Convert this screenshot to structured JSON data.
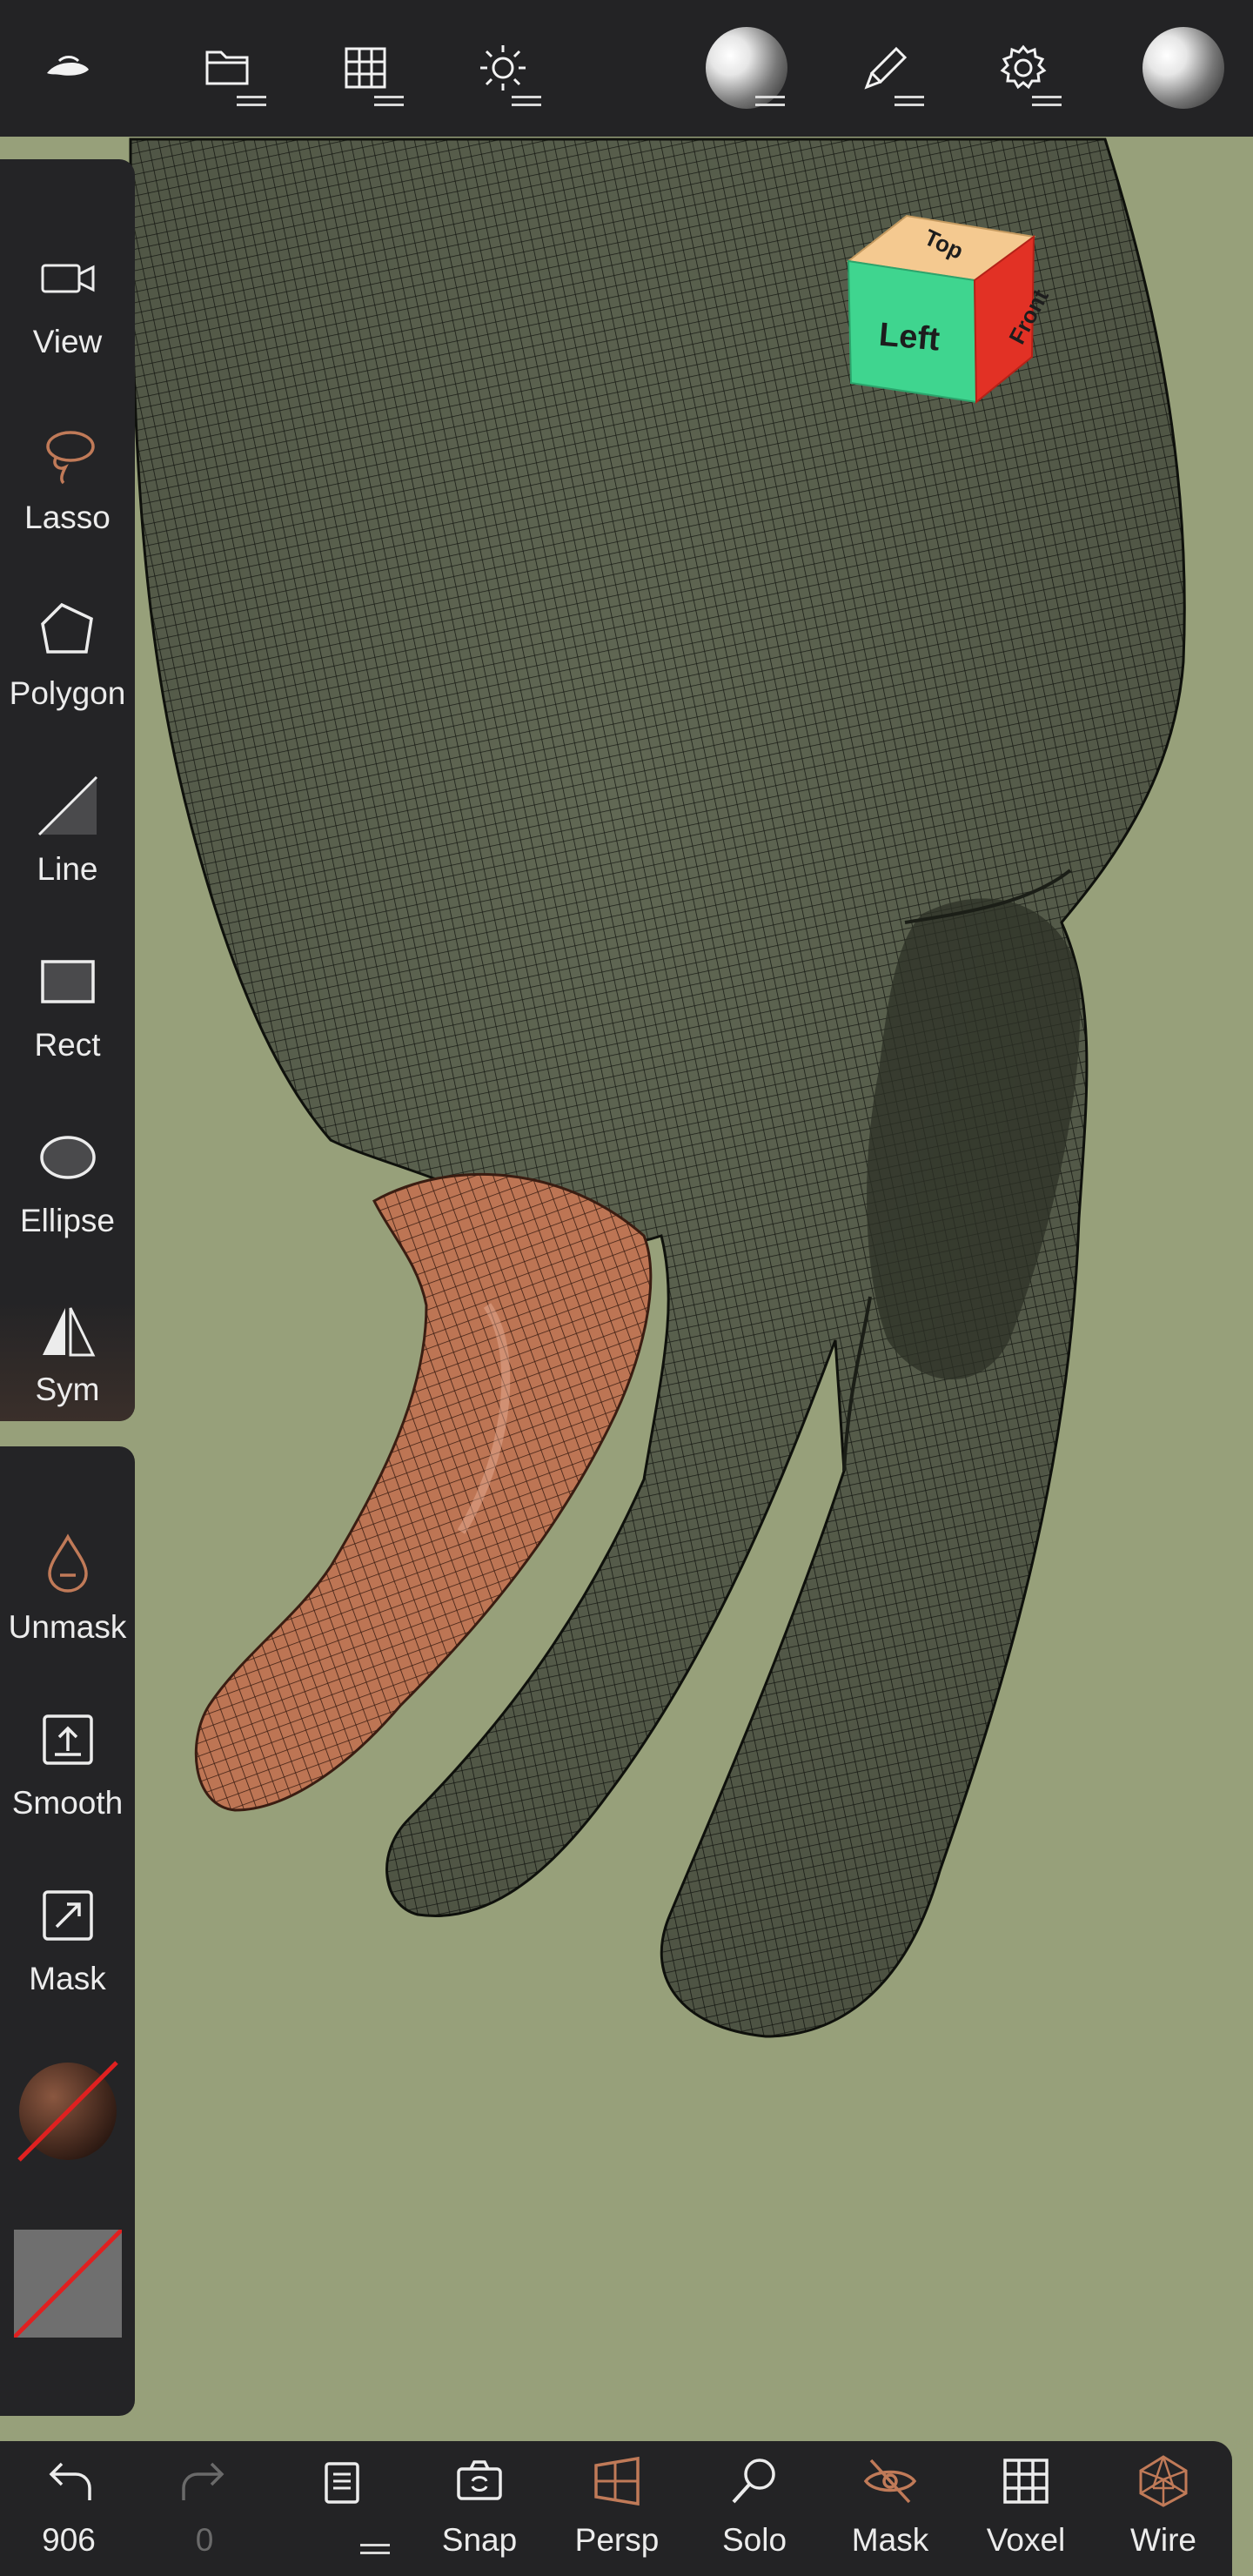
{
  "topbar": {
    "items": [
      {
        "icon": "app-logo-icon"
      },
      {
        "icon": "folder-icon"
      },
      {
        "icon": "grid-icon"
      },
      {
        "icon": "sun-icon"
      },
      {
        "icon": "matcap-sphere-icon"
      },
      {
        "icon": "brush-icon"
      },
      {
        "icon": "gear-icon"
      },
      {
        "icon": "matcap-sphere-icon"
      }
    ]
  },
  "view_cube": {
    "face_left": "Left",
    "face_top": "Top",
    "face_front": "Front"
  },
  "tools_panel": {
    "items": [
      {
        "label": "View",
        "icon": "camera-icon"
      },
      {
        "label": "Lasso",
        "icon": "lasso-icon"
      },
      {
        "label": "Polygon",
        "icon": "polygon-icon"
      },
      {
        "label": "Line",
        "icon": "line-icon"
      },
      {
        "label": "Rect",
        "icon": "rect-icon"
      },
      {
        "label": "Ellipse",
        "icon": "ellipse-icon"
      },
      {
        "label": "Sym",
        "icon": "symmetry-icon"
      }
    ]
  },
  "mask_panel": {
    "items": [
      {
        "label": "Unmask",
        "icon": "drop-minus-icon"
      },
      {
        "label": "Smooth",
        "icon": "upload-box-icon"
      },
      {
        "label": "Mask",
        "icon": "mask-box-icon"
      }
    ]
  },
  "bottombar": {
    "undo_count": "906",
    "redo_count": "0",
    "items": [
      {
        "label": "Snap",
        "icon": "camera-rotate-icon"
      },
      {
        "label": "Persp",
        "icon": "perspective-icon"
      },
      {
        "label": "Solo",
        "icon": "search-icon"
      },
      {
        "label": "Mask",
        "icon": "eye-off-icon"
      },
      {
        "label": "Voxel",
        "icon": "voxel-grid-icon"
      },
      {
        "label": "Wire",
        "icon": "wireframe-icon"
      }
    ]
  },
  "colors": {
    "background": "#97a07a",
    "mesh_fill": "#5d6450",
    "mesh_wire": "#1a1d16",
    "accent_orange": "#c07a58",
    "finger_fill": "#b8704f"
  }
}
